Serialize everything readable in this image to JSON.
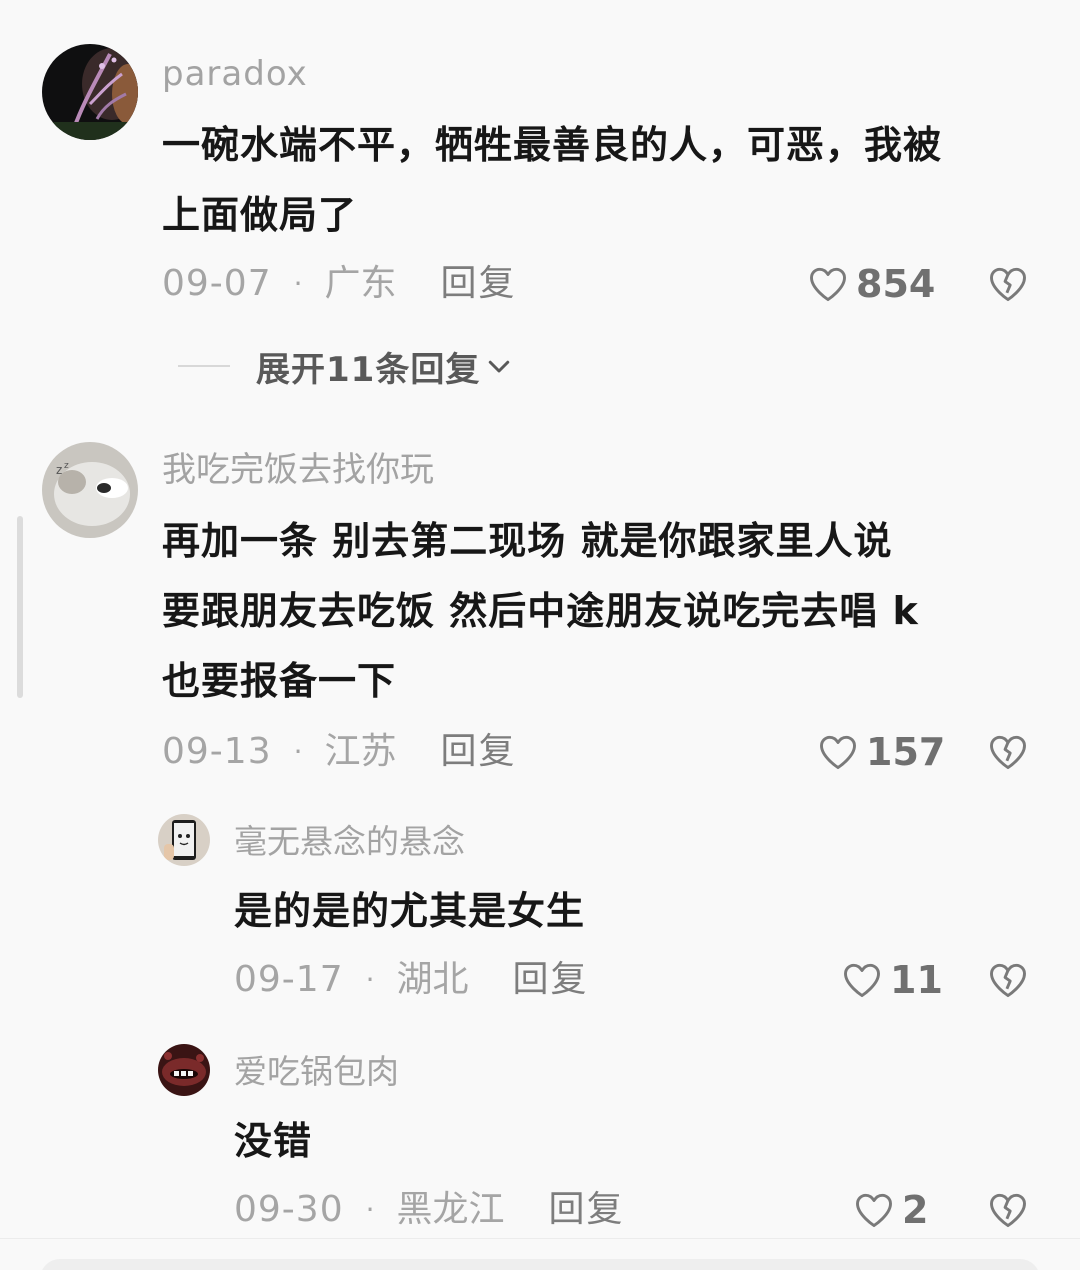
{
  "comments": [
    {
      "username": "paradox",
      "lines": [
        "一碗水端不平，牺牲最善良的人，可恶，我被",
        "上面做局了"
      ],
      "date": "09-07",
      "location": "广东",
      "reply_label": "回复",
      "likes": "854",
      "expand_label": "展开11条回复"
    },
    {
      "username": "我吃完饭去找你玩",
      "lines": [
        "再加一条  别去第二现场  就是你跟家里人说",
        "要跟朋友去吃饭  然后中途朋友说吃完去唱 k",
        "也要报备一下"
      ],
      "date": "09-13",
      "location": "江苏",
      "reply_label": "回复",
      "likes": "157",
      "replies": [
        {
          "username": "毫无悬念的悬念",
          "lines": [
            "是的是的尤其是女生"
          ],
          "date": "09-17",
          "location": "湖北",
          "reply_label": "回复",
          "likes": "11"
        },
        {
          "username": "爱吃锅包肉",
          "lines": [
            "没错"
          ],
          "date": "09-30",
          "location": "黑龙江",
          "reply_label": "回复",
          "likes": "2"
        }
      ]
    }
  ],
  "icons": {
    "like": "heart-outline-icon",
    "dislike": "broken-heart-icon",
    "expand": "chevron-down-icon"
  },
  "colors": {
    "background": "#f9f9f9",
    "username": "#a3a3a3",
    "meta": "#a5a5a5",
    "text": "#171717"
  }
}
